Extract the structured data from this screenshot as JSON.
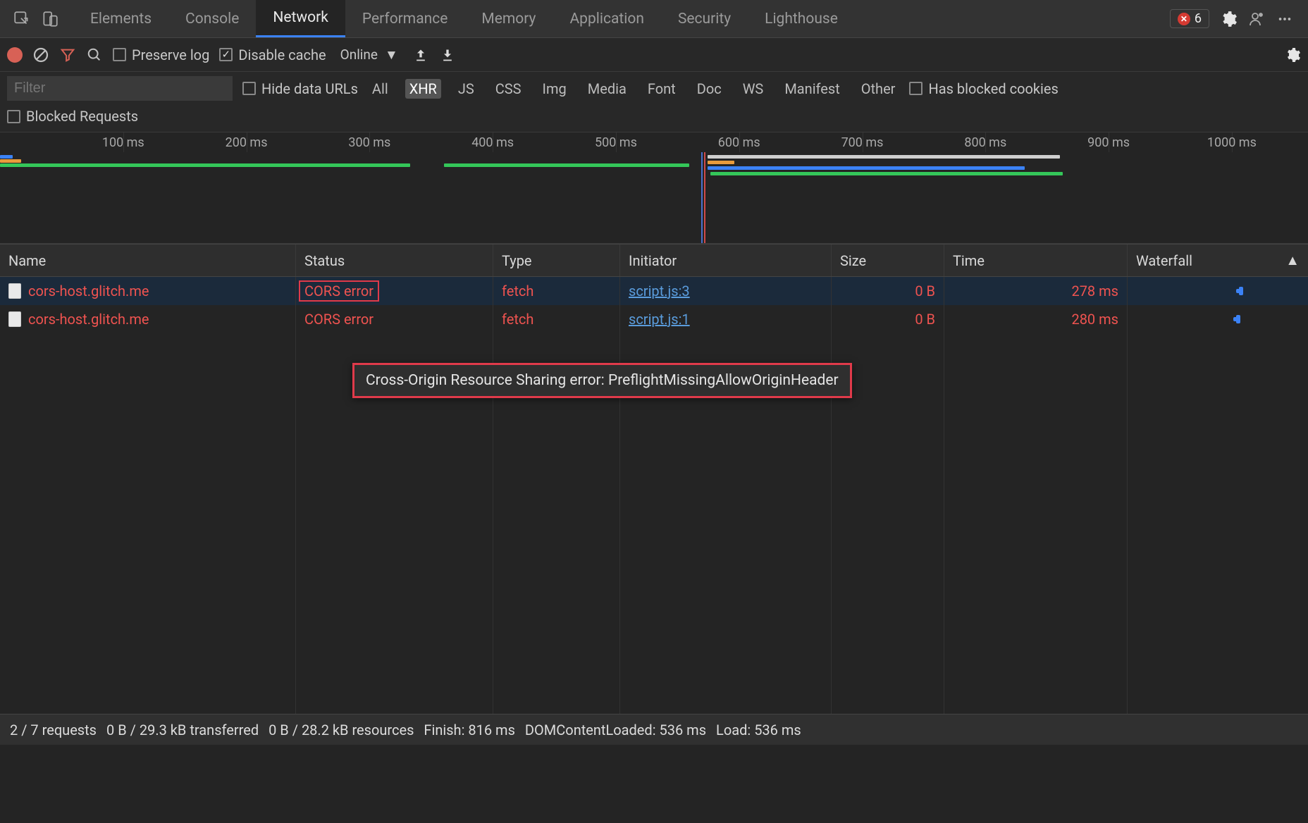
{
  "tabs": [
    {
      "label": "Elements"
    },
    {
      "label": "Console"
    },
    {
      "label": "Network",
      "active": true
    },
    {
      "label": "Performance"
    },
    {
      "label": "Memory"
    },
    {
      "label": "Application"
    },
    {
      "label": "Security"
    },
    {
      "label": "Lighthouse"
    }
  ],
  "error_count": "6",
  "toolbar": {
    "preserve_log": "Preserve log",
    "disable_cache": "Disable cache",
    "throttling": "Online"
  },
  "filter": {
    "placeholder": "Filter",
    "hide_data_urls": "Hide data URLs",
    "types": [
      "All",
      "XHR",
      "JS",
      "CSS",
      "Img",
      "Media",
      "Font",
      "Doc",
      "WS",
      "Manifest",
      "Other"
    ],
    "active_type": "XHR",
    "has_blocked_cookies": "Has blocked cookies",
    "blocked_requests": "Blocked Requests"
  },
  "timeline_ticks": [
    "100 ms",
    "200 ms",
    "300 ms",
    "400 ms",
    "500 ms",
    "600 ms",
    "700 ms",
    "800 ms",
    "900 ms",
    "1000 ms"
  ],
  "columns": {
    "name": "Name",
    "status": "Status",
    "type": "Type",
    "initiator": "Initiator",
    "size": "Size",
    "time": "Time",
    "waterfall": "Waterfall"
  },
  "rows": [
    {
      "name": "cors-host.glitch.me",
      "status": "CORS error",
      "type": "fetch",
      "initiator": "script.js:1",
      "size": "0 B",
      "time": "280 ms",
      "selected": false,
      "status_highlight": false
    },
    {
      "name": "cors-host.glitch.me",
      "status": "CORS error",
      "type": "fetch",
      "initiator": "script.js:3",
      "size": "0 B",
      "time": "278 ms",
      "selected": true,
      "status_highlight": true
    }
  ],
  "tooltip": "Cross-Origin Resource Sharing error: PreflightMissingAllowOriginHeader",
  "footer": {
    "requests": "2 / 7 requests",
    "transferred": "0 B / 29.3 kB transferred",
    "resources": "0 B / 28.2 kB resources",
    "finish": "Finish: 816 ms",
    "dom": "DOMContentLoaded: 536 ms",
    "load": "Load: 536 ms"
  }
}
